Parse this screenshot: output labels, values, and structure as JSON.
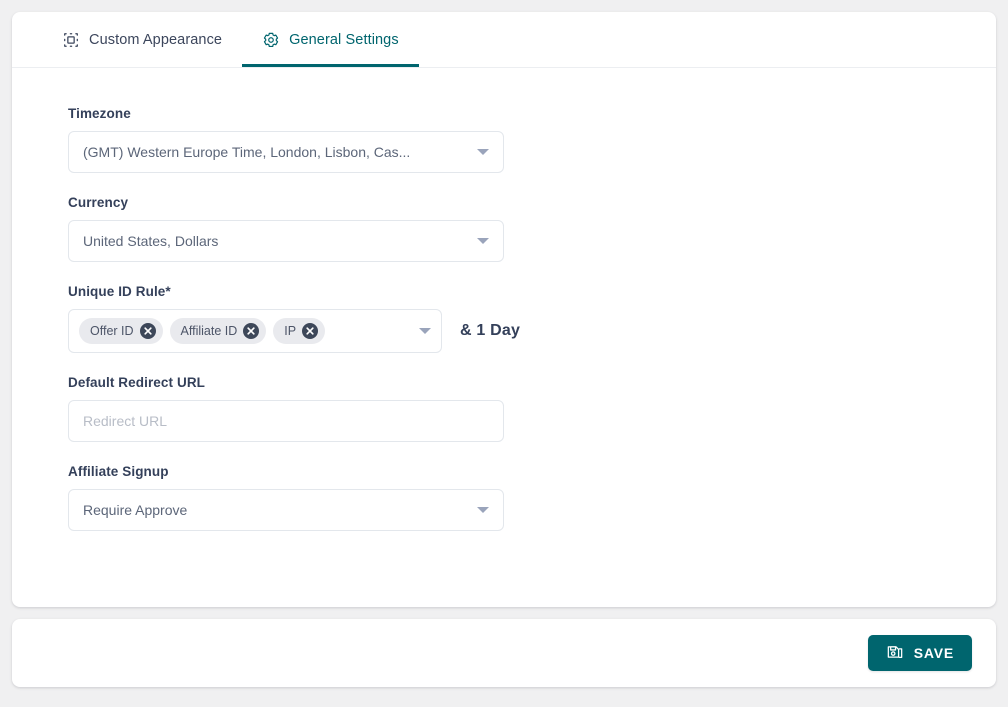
{
  "tabs": [
    {
      "id": "custom-appearance",
      "label": "Custom Appearance",
      "icon": "selection-frame-icon",
      "active": false
    },
    {
      "id": "general-settings",
      "label": "General Settings",
      "icon": "gear-icon",
      "active": true
    }
  ],
  "form": {
    "timezone": {
      "label": "Timezone",
      "value": "(GMT) Western Europe Time, London, Lisbon, Cas..."
    },
    "currency": {
      "label": "Currency",
      "value": "United States, Dollars"
    },
    "unique_id_rule": {
      "label": "Unique ID Rule*",
      "chips": [
        "Offer ID",
        "Affiliate ID",
        "IP"
      ],
      "suffix": "& 1 Day"
    },
    "default_redirect_url": {
      "label": "Default Redirect URL",
      "value": "",
      "placeholder": "Redirect URL"
    },
    "affiliate_signup": {
      "label": "Affiliate Signup",
      "value": "Require Approve"
    }
  },
  "footer": {
    "save_label": "SAVE",
    "save_icon": "save-floppy-icon"
  },
  "colors": {
    "accent": "#00656e",
    "page_background": "#f0f0f1",
    "card": "#ffffff",
    "label_text": "#34405a",
    "value_text": "#5c6679",
    "placeholder_text": "#b8bdc7",
    "chip_background": "#e9eaee",
    "chip_remove": "#3d4759",
    "border": "#e3e7ec"
  }
}
